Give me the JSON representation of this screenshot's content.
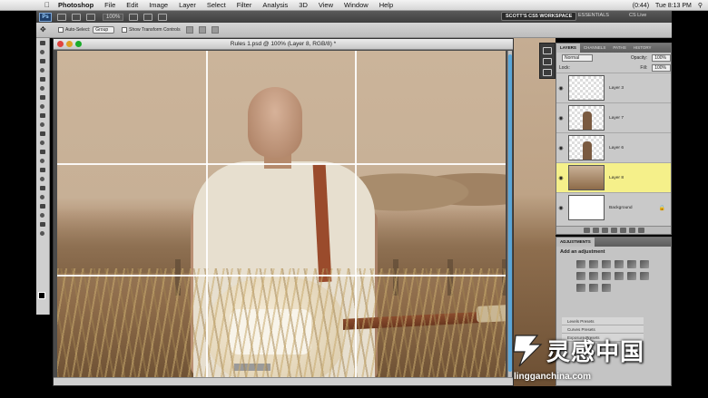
{
  "menubar": {
    "apple_icon": "apple-icon",
    "items": [
      "Photoshop",
      "File",
      "Edit",
      "Image",
      "Layer",
      "Select",
      "Filter",
      "Analysis",
      "3D",
      "View",
      "Window",
      "Help"
    ],
    "status": {
      "battery": "(0:44)",
      "clock": "Tue 8:13 PM",
      "spotlight_icon": "search-icon"
    }
  },
  "appbar": {
    "logo": "Ps",
    "zoom": "100%",
    "workspace": "SCOTT'S CS5 WORKSPACE",
    "essentials": "ESSENTIALS",
    "cslive": "CS Live"
  },
  "options": {
    "auto_select_label": "Auto-Select:",
    "auto_select_value": "Group",
    "show_transform_label": "Show Transform Controls"
  },
  "document": {
    "title": "Rules 1.psd @ 100% (Layer 8, RGB/8) *"
  },
  "layers_panel": {
    "tabs": [
      "LAYERS",
      "CHANNELS",
      "PATHS",
      "HISTORY"
    ],
    "blend_mode": "Normal",
    "opacity_label": "Opacity:",
    "opacity_value": "100%",
    "lock_label": "Lock:",
    "fill_label": "Fill:",
    "fill_value": "100%",
    "layers": [
      {
        "name": "Layer 3",
        "thumb": "checker",
        "selected": false
      },
      {
        "name": "Layer 7",
        "thumb": "fig",
        "selected": false
      },
      {
        "name": "Layer 6",
        "thumb": "fig",
        "selected": false
      },
      {
        "name": "Layer 8",
        "thumb": "photo",
        "selected": true
      },
      {
        "name": "Background",
        "thumb": "white",
        "selected": false
      }
    ]
  },
  "adjustments_panel": {
    "tab": "ADJUSTMENTS",
    "title": "Add an adjustment",
    "presets": [
      "Levels Presets",
      "Curves Presets",
      "Exposure Presets"
    ]
  },
  "watermark": {
    "cn": "灵感中国",
    "url": "lingganchina.com"
  }
}
